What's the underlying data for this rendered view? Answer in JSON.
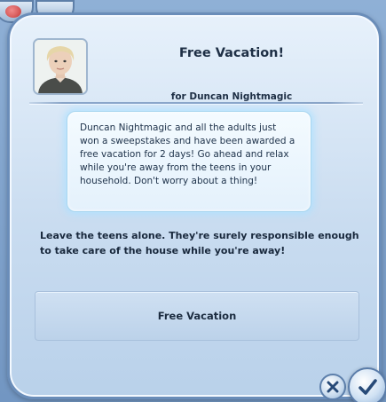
{
  "dialog": {
    "title": "Free Vacation!",
    "subtitle": "for Duncan Nightmagic",
    "message": "Duncan Nightmagic and all the adults just won a sweepstakes and have been awarded a free vacation for 2 days! Go ahead and relax while you're away from the teens in your household. Don't worry about a thing!",
    "prompt": "Leave the teens alone. They're surely responsible enough to take care of the house while you're away!",
    "option_label": "Free Vacation"
  },
  "icons": {
    "portrait": "sim-portrait",
    "cancel": "close-x-icon",
    "confirm": "checkmark-icon"
  },
  "colors": {
    "panel": "#d5e5f5",
    "frame": "#6a8db9",
    "text": "#1e2f45",
    "glow": "#afe1ff"
  }
}
